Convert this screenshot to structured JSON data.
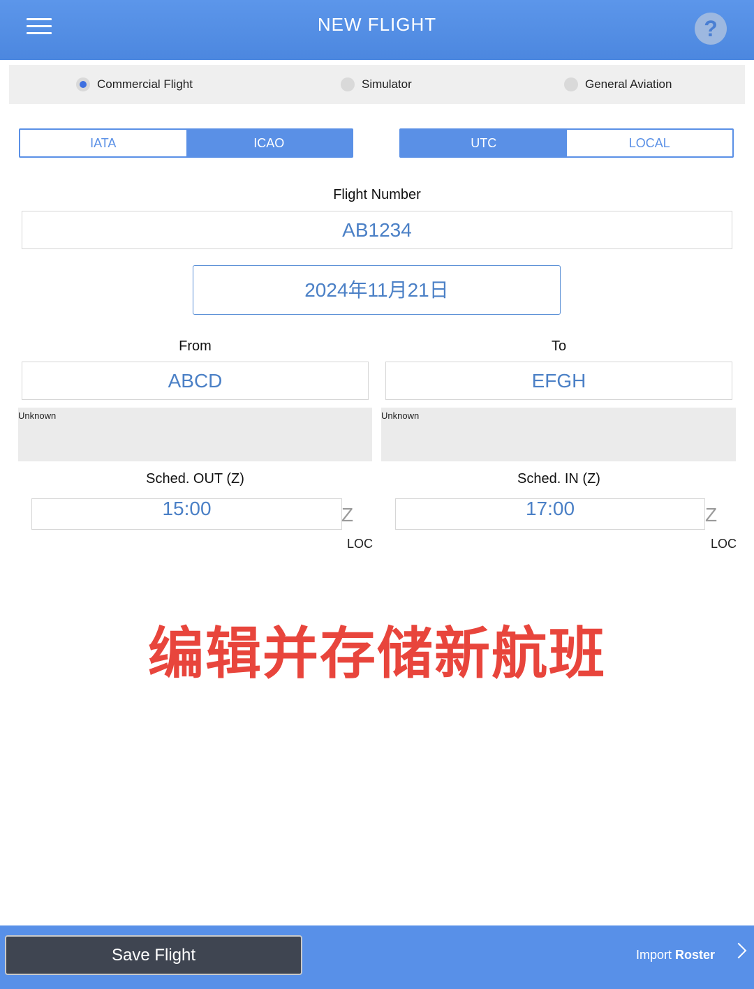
{
  "header": {
    "title": "NEW FLIGHT",
    "help_glyph": "?"
  },
  "flight_type": {
    "options": [
      "Commercial Flight",
      "Simulator",
      "General Aviation"
    ],
    "selected": "Commercial Flight"
  },
  "code_toggle": {
    "options": [
      "IATA",
      "ICAO"
    ],
    "selected": "ICAO"
  },
  "time_toggle": {
    "options": [
      "UTC",
      "LOCAL"
    ],
    "selected": "UTC"
  },
  "flight_number": {
    "label": "Flight Number",
    "value": "AB1234"
  },
  "date": {
    "value": "2024年11月21日"
  },
  "from": {
    "label": "From",
    "value": "ABCD",
    "name": "Unknown"
  },
  "to": {
    "label": "To",
    "value": "EFGH",
    "name": "Unknown"
  },
  "sched_out": {
    "label": "Sched. OUT (Z)",
    "value": "15:00",
    "zone": "Z",
    "loc": "LOC"
  },
  "sched_in": {
    "label": "Sched. IN (Z)",
    "value": "17:00",
    "zone": "Z",
    "loc": "LOC"
  },
  "overlay_caption": "编辑并存储新航班",
  "footer": {
    "save_label": "Save Flight",
    "import_prefix": "Import",
    "import_bold": "Roster"
  },
  "colors": {
    "header": "#4c87df",
    "accent": "#5a90e6",
    "caption": "#e8453c",
    "save_button": "#3f4551"
  }
}
